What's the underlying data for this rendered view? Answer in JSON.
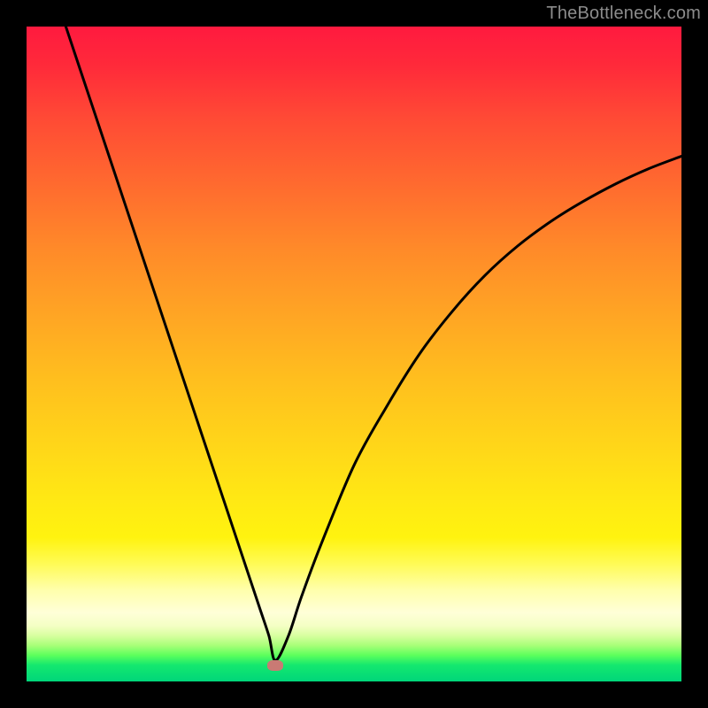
{
  "watermark": "TheBottleneck.com",
  "colors": {
    "frame": "#000000",
    "curve_stroke": "#000000",
    "marker_fill": "#c97a74",
    "watermark": "#8c8c8c"
  },
  "chart_data": {
    "type": "line",
    "title": "",
    "xlabel": "",
    "ylabel": "",
    "xlim": [
      0,
      100
    ],
    "ylim": [
      0,
      100
    ],
    "grid": false,
    "legend": null,
    "series": [
      {
        "name": "bottleneck-curve",
        "x": [
          6,
          10,
          15,
          20,
          25,
          30,
          33,
          35.5,
          37,
          38,
          40,
          42,
          45,
          50,
          55,
          60,
          65,
          70,
          75,
          80,
          85,
          90,
          95,
          100
        ],
        "y": [
          100,
          88,
          73,
          58,
          43,
          28,
          19,
          11.5,
          7,
          3.2,
          7,
          13,
          21,
          33,
          42,
          50,
          56.5,
          62,
          66.5,
          70.2,
          73.3,
          76,
          78.3,
          80.2
        ]
      }
    ],
    "annotations": [
      {
        "type": "optimum-marker",
        "x": 38,
        "y": 2.4
      }
    ],
    "background_zones": [
      {
        "from_y": 100,
        "to_y": 18,
        "gradient": "red-to-yellow"
      },
      {
        "from_y": 18,
        "to_y": 6,
        "gradient": "pale-yellow"
      },
      {
        "from_y": 6,
        "to_y": 0,
        "gradient": "green"
      }
    ]
  }
}
